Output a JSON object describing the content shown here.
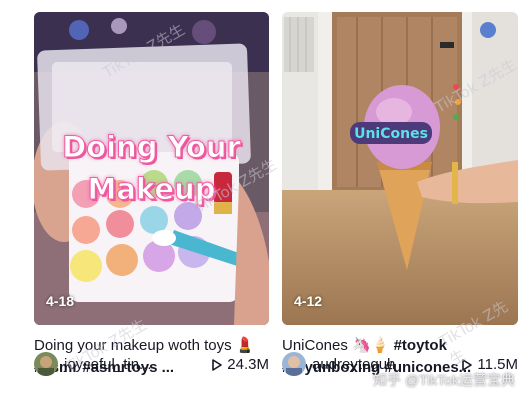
{
  "videos": [
    {
      "date": "4-18",
      "overlay_line1": "Doing Your",
      "overlay_line2": "Makeup",
      "caption_text": "Doing your makeup woth toys",
      "caption_emoji": "💄",
      "hashtags_line2": [
        "#asmr",
        "#asmrtoys",
        "..."
      ],
      "username": "joyceful_tin...",
      "views": "24.3M"
    },
    {
      "date": "4-12",
      "caption_text": "UniCones",
      "caption_emoji": "🦄🍦",
      "hashtag_line1": "#toytok",
      "hashtags_line2": [
        "#toyunboxing",
        "#unicones..."
      ],
      "username": "audreyteguh",
      "views": "11.5M",
      "logo_text": "UniCones"
    }
  ],
  "watermarks": [
    "TikTok Z先生",
    "TikTok Z先生",
    "TikTok Z先生",
    "TikTok Z先生",
    "TikTok Z先生"
  ],
  "credit": "知乎 @TikTok运营宝典",
  "icons": {
    "play": "play-icon"
  }
}
